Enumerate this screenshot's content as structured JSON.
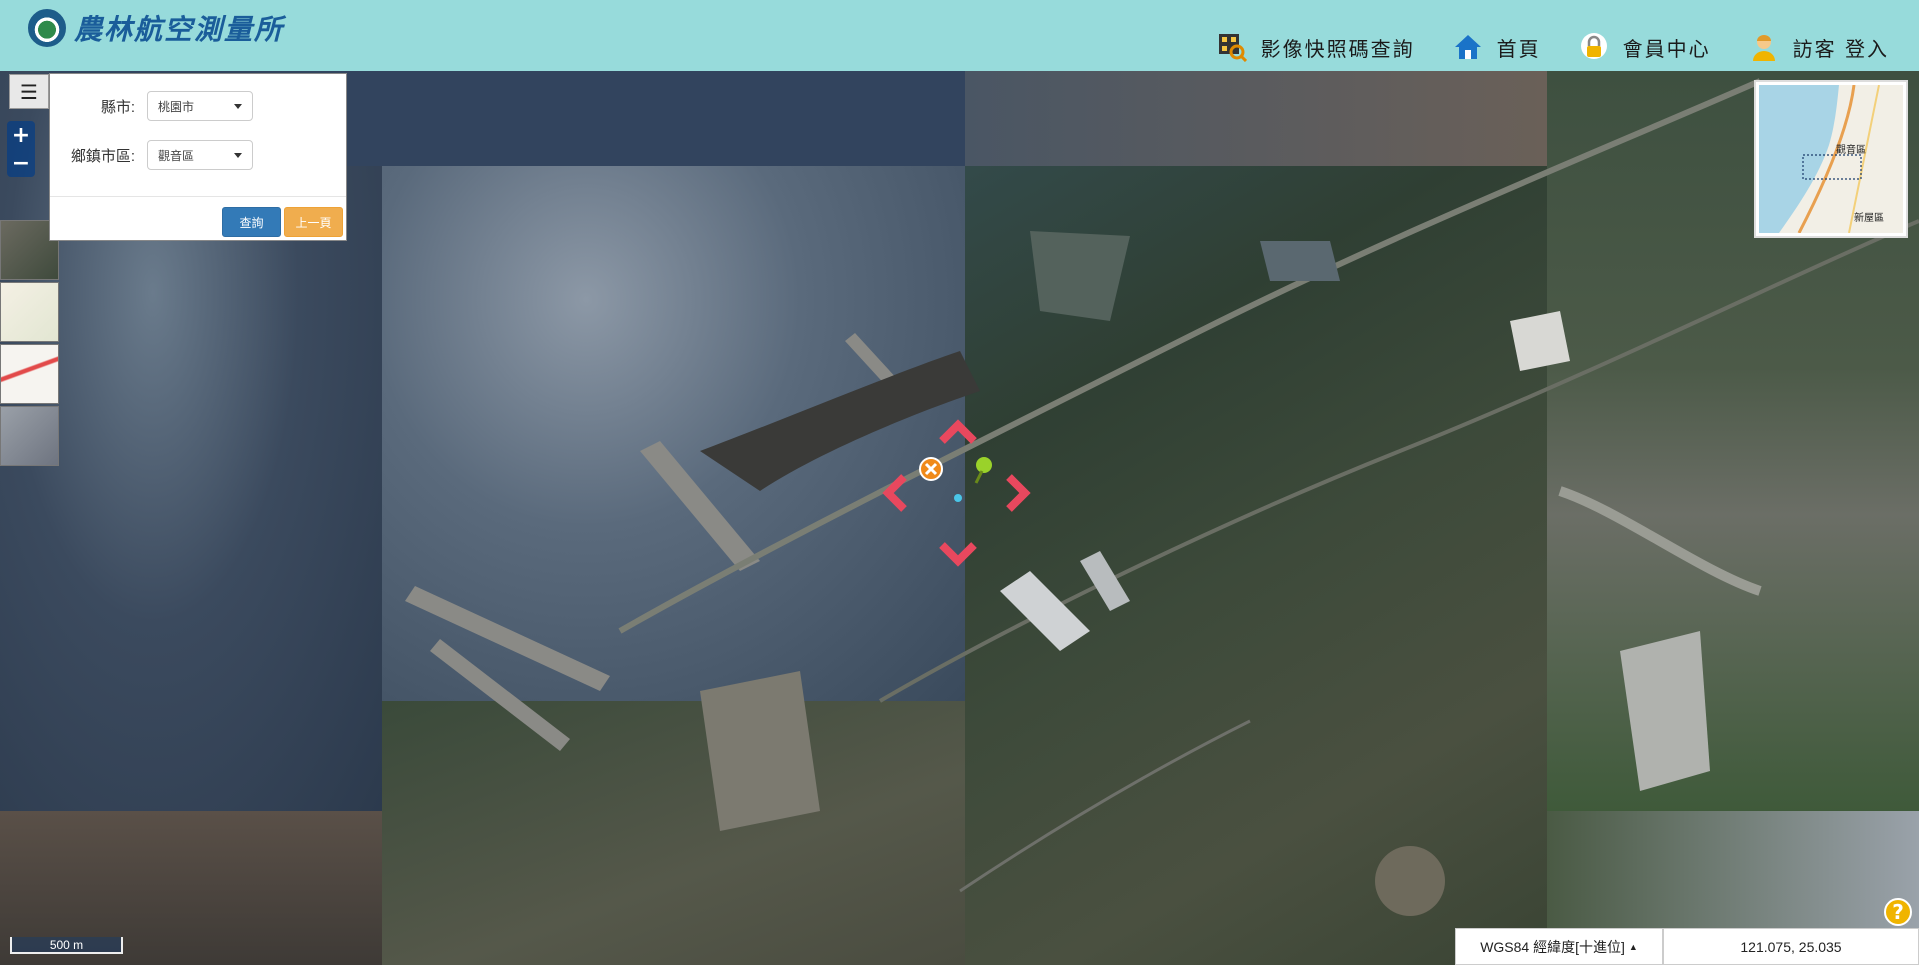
{
  "header": {
    "logo_text": "農林航空測量所",
    "nav": [
      {
        "label": "影像快照碼查詢",
        "icon": "qr-search-icon"
      },
      {
        "label": "首頁",
        "icon": "home-icon"
      },
      {
        "label": "會員中心",
        "icon": "lock-icon"
      },
      {
        "label": "訪客 登入",
        "icon": "user-icon"
      }
    ]
  },
  "panel": {
    "county_label": "縣市:",
    "county_value": "桃園市",
    "township_label": "鄉鎮市區:",
    "township_value": "觀音區",
    "query_button": "查詢",
    "prev_button": "上一頁"
  },
  "map": {
    "menu_icon": "☰",
    "zoom_in": "+",
    "zoom_out": "−",
    "scale": "500 m",
    "overview_labels": [
      "觀音區",
      "新屋區"
    ],
    "projection": "WGS84 經緯度[十進位]",
    "coordinates": "121.075, 25.035",
    "help": "?"
  }
}
